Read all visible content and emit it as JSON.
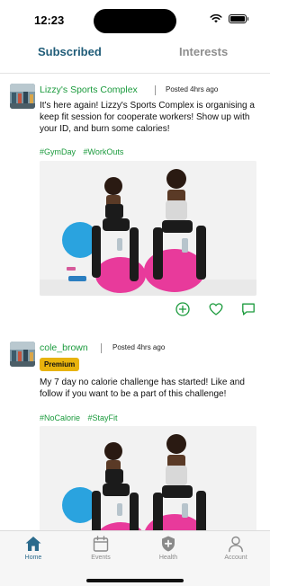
{
  "status_bar": {
    "time": "12:23"
  },
  "tabs": [
    {
      "label": "Subscribed",
      "active": true
    },
    {
      "label": "Interests",
      "active": false
    }
  ],
  "posts": [
    {
      "author": "Lizzy's Sports Complex",
      "posted": "Posted 4hrs ago",
      "body": "It's here again! Lizzy's Sports Complex is organising a keep fit session for cooperate workers! Show up with your ID, and burn some calories!",
      "tags": [
        "#GymDay",
        "#WorkOuts"
      ],
      "actions": [
        "add-circle-icon",
        "heart-icon",
        "comment-icon"
      ]
    },
    {
      "author": "cole_brown",
      "posted": "Posted 4hrs ago",
      "badge": "Premium",
      "body": "My 7 day no calorie challenge has started! Like and follow if you want to be a part of this challenge!",
      "tags": [
        "#NoCalorie",
        "#StayFit"
      ]
    }
  ],
  "bottom_nav": [
    {
      "label": "Home",
      "icon": "home-icon",
      "active": true
    },
    {
      "label": "Events",
      "icon": "calendar-icon",
      "active": false
    },
    {
      "label": "Health",
      "icon": "shield-plus-icon",
      "active": false
    },
    {
      "label": "Account",
      "icon": "person-icon",
      "active": false
    }
  ],
  "colors": {
    "brand_blue": "#1f5c78",
    "green": "#1a9a3c",
    "badge_gold": "#e8b30d",
    "inactive_gray": "#8e8e8e"
  }
}
